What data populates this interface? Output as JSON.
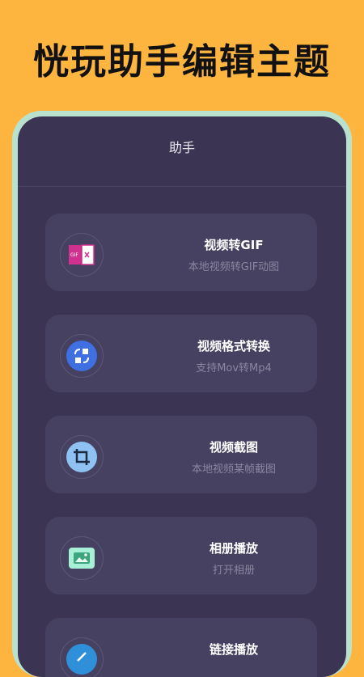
{
  "banner": {
    "title": "恍玩助手编辑主题"
  },
  "nav": {
    "title": "助手"
  },
  "items": [
    {
      "title": "视频转GIF",
      "subtitle": "本地视频转GIF动图",
      "icon": "gif-convert-icon"
    },
    {
      "title": "视频格式转换",
      "subtitle": "支持Mov转Mp4",
      "icon": "format-convert-icon"
    },
    {
      "title": "视频截图",
      "subtitle": "本地视频某帧截图",
      "icon": "crop-icon"
    },
    {
      "title": "相册播放",
      "subtitle": "打开相册",
      "icon": "gallery-icon"
    },
    {
      "title": "链接播放",
      "subtitle": "",
      "icon": "link-icon"
    }
  ],
  "colors": {
    "background": "#FDB53F",
    "phone_frame": "#B8E2CD",
    "screen": "#3B3553",
    "card": "#474161",
    "accent_blue": "#3F6FE0",
    "accent_pink": "#D0318E"
  }
}
